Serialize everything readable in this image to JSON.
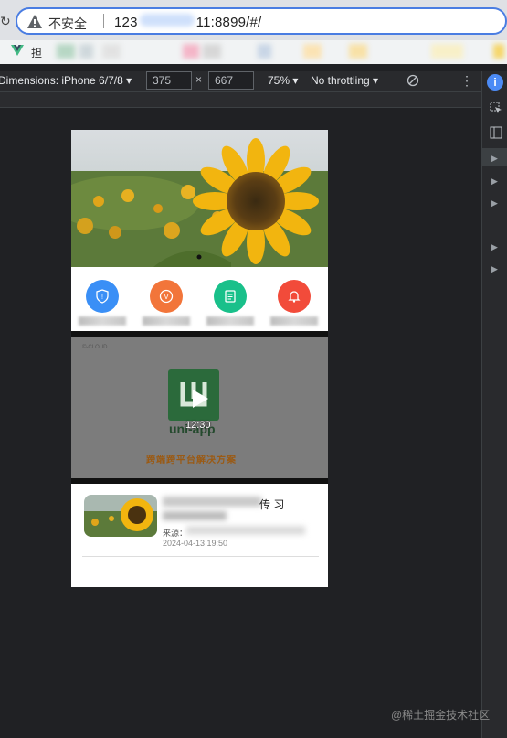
{
  "browser": {
    "security_label": "不安全",
    "url_visible_start": "123",
    "url_visible_end": "11:8899/#/",
    "bookmark_first_char": "担"
  },
  "device_toolbar": {
    "dimensions_label": "Dimensions: iPhone 6/7/8 ▾",
    "width_value": "375",
    "height_value": "667",
    "times_symbol": "×",
    "zoom_label": "75% ▾",
    "throttle_label": "No throttling ▾",
    "more_glyph": "⋮"
  },
  "devtools": {
    "info_glyph": "i",
    "expand_glyph": "▶"
  },
  "app": {
    "icons": [
      {
        "name": "shield",
        "color": "#3a8ff6"
      },
      {
        "name": "vip",
        "color": "#f2753a"
      },
      {
        "name": "document",
        "color": "#19c08a"
      },
      {
        "name": "bell",
        "color": "#f24b3a"
      }
    ],
    "video": {
      "cloud_label": "©-CLOUD",
      "logo_text": "uni-app",
      "slogan": "跨端跨平台解决方案",
      "duration": "12:30"
    },
    "news": {
      "title_tail": "传   习",
      "source_prefix": "来源：",
      "date": "2024-04-13 19:50"
    }
  },
  "watermark": "@稀土掘金技术社区"
}
